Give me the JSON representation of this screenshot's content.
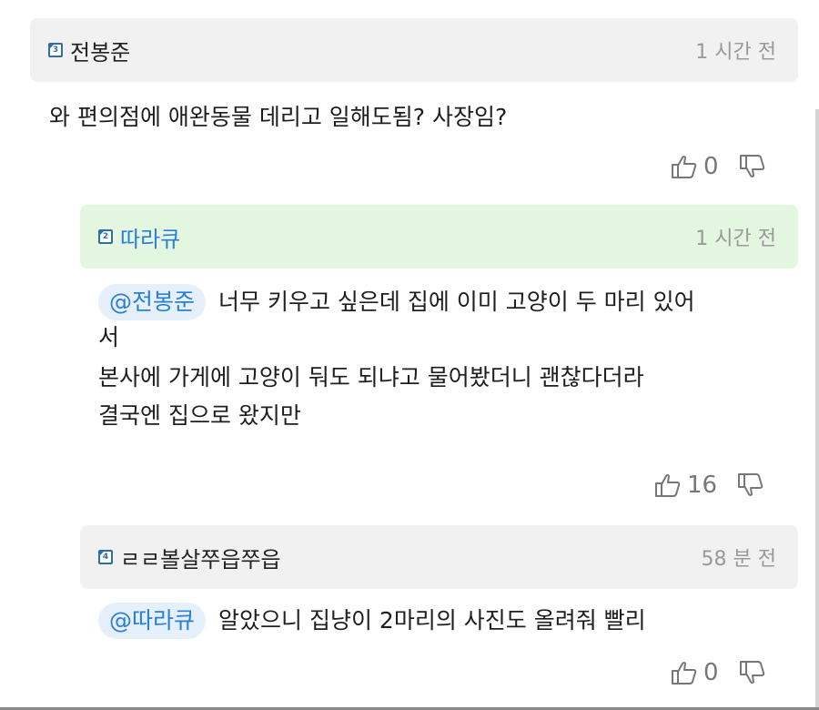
{
  "comments": [
    {
      "level": "3",
      "nick": "전봉준",
      "time": "1 시간 전",
      "text": "와 편의점에 애완동물 데리고 일해도됨? 사장임?",
      "likes": "0",
      "header_bg": "#f1f1f1"
    },
    {
      "level": "2",
      "nick": "따라큐",
      "time": "1 시간 전",
      "mention": "@전봉준",
      "text_line1": "너무 키우고 싶은데 집에 이미 고양이 두 마리 있어",
      "text_line2": "서",
      "text_line3": "본사에 가게에 고양이 둬도 되냐고 물어봤더니 괜찮다더라",
      "text_line4": "결국엔 집으로 왔지만",
      "likes": "16",
      "header_bg": "#e3f6df"
    },
    {
      "level": "4",
      "nick": "ㄹㄹ볼살쭈읍쭈읍",
      "time": "58 분 전",
      "mention": "@따라큐",
      "text": "알았으니 집냥이 2마리의 사진도 올려줘 빨리",
      "likes": "0",
      "header_bg": "#f1f1f1"
    }
  ],
  "colors": {
    "mention_text": "#2a7fd6",
    "mention_bg": "#e6f0fb",
    "badge": "#2f6fa1",
    "time": "#999999"
  },
  "icons": {
    "like": "thumbs-up-outline",
    "dislike": "thumbs-down-outline",
    "badge": "level-badge"
  }
}
